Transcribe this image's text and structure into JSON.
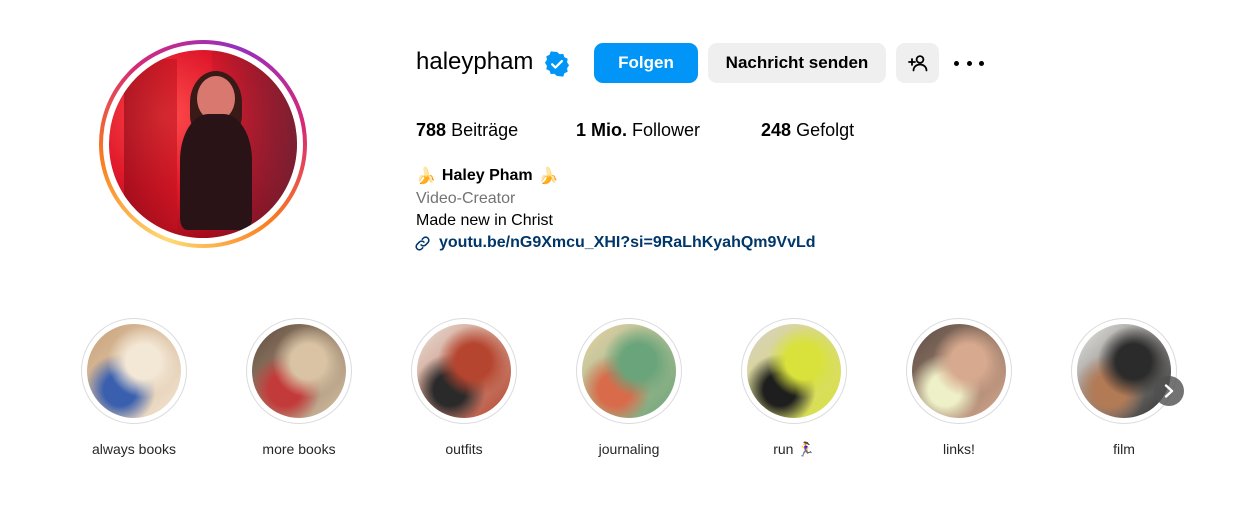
{
  "profile": {
    "username": "haleypham",
    "verified": true,
    "buttons": {
      "follow": "Folgen",
      "message": "Nachricht senden"
    },
    "icons": {
      "verified": "verified-badge-icon",
      "suggest": "add-person-icon",
      "more": "more-options-icon",
      "link": "link-icon"
    },
    "stats": {
      "posts_value": "788",
      "posts_label": "Beiträge",
      "followers_value": "1 Mio.",
      "followers_label": "Follower",
      "following_value": "248",
      "following_label": "Gefolgt"
    },
    "bio": {
      "emoji_left": "🍌",
      "name": "Haley Pham",
      "emoji_right": "🍌",
      "category": "Video-Creator",
      "text": "Made new in Christ",
      "link": "youtu.be/nG9Xmcu_XHI?si=9RaLhKyahQm9VvLd"
    }
  },
  "highlights": [
    {
      "label": "always books",
      "colors": [
        "#c8a078",
        "#f3e7d5",
        "#3a5fae"
      ]
    },
    {
      "label": "more books",
      "colors": [
        "#5f4a3c",
        "#d9c3a4",
        "#c33a3a"
      ]
    },
    {
      "label": "outfits",
      "colors": [
        "#e8e2d8",
        "#b5452e",
        "#2a2a2a"
      ]
    },
    {
      "label": "journaling",
      "colors": [
        "#e9d3a7",
        "#6aa47a",
        "#d96b4a"
      ]
    },
    {
      "label": "run 🏃‍♀️",
      "colors": [
        "#d8d0c6",
        "#d9e23b",
        "#1e1e1e"
      ]
    },
    {
      "label": "links!",
      "colors": [
        "#5a4c44",
        "#d7a98e",
        "#eef0c8"
      ]
    },
    {
      "label": "film",
      "colors": [
        "#ebe8e3",
        "#2b2b2b",
        "#b37a56"
      ]
    }
  ],
  "colors": {
    "accent": "#0095f6",
    "link": "#00376b",
    "secondary_text": "#737373",
    "button_bg": "#efefef"
  }
}
